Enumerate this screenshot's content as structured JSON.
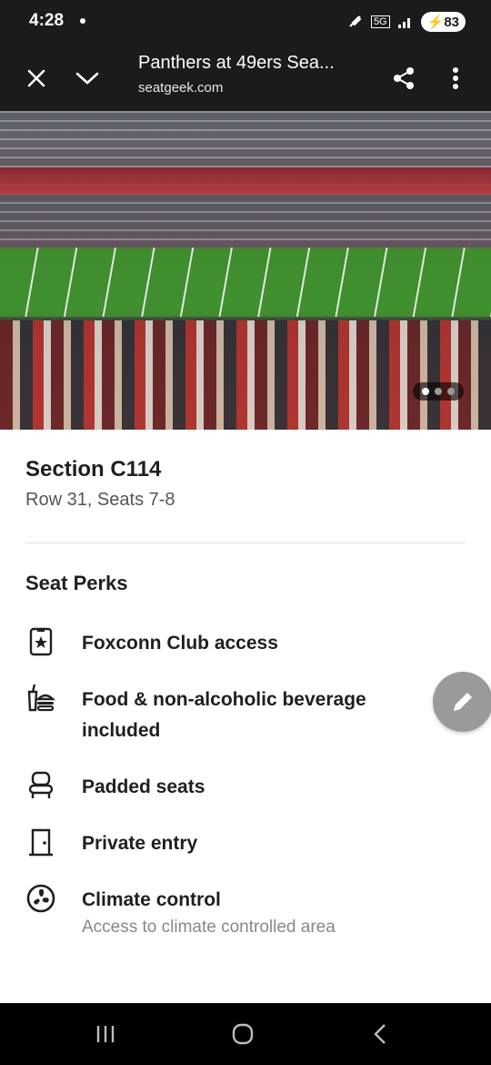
{
  "status": {
    "time": "4:28",
    "network": "5G",
    "battery": "83"
  },
  "browser": {
    "title": "Panthers at 49ers Sea...",
    "url": "seatgeek.com"
  },
  "carousel": {
    "total_slides": 3,
    "active_index": 0
  },
  "seat": {
    "section": "Section C114",
    "detail": "Row 31, Seats 7-8"
  },
  "perks": {
    "heading": "Seat Perks",
    "items": [
      {
        "icon": "club-badge-icon",
        "label": "Foxconn Club access",
        "sub": ""
      },
      {
        "icon": "food-beverage-icon",
        "label": "Food & non-alcoholic beverage included",
        "sub": ""
      },
      {
        "icon": "padded-seat-icon",
        "label": "Padded seats",
        "sub": ""
      },
      {
        "icon": "door-icon",
        "label": "Private entry",
        "sub": ""
      },
      {
        "icon": "fan-icon",
        "label": "Climate control",
        "sub": "Access to climate controlled area"
      }
    ]
  },
  "colors": {
    "toolbar_bg": "#1b1b1b",
    "fab_bg": "#9a9a9a",
    "text_primary": "#1f1f1f",
    "text_secondary": "#555555"
  }
}
